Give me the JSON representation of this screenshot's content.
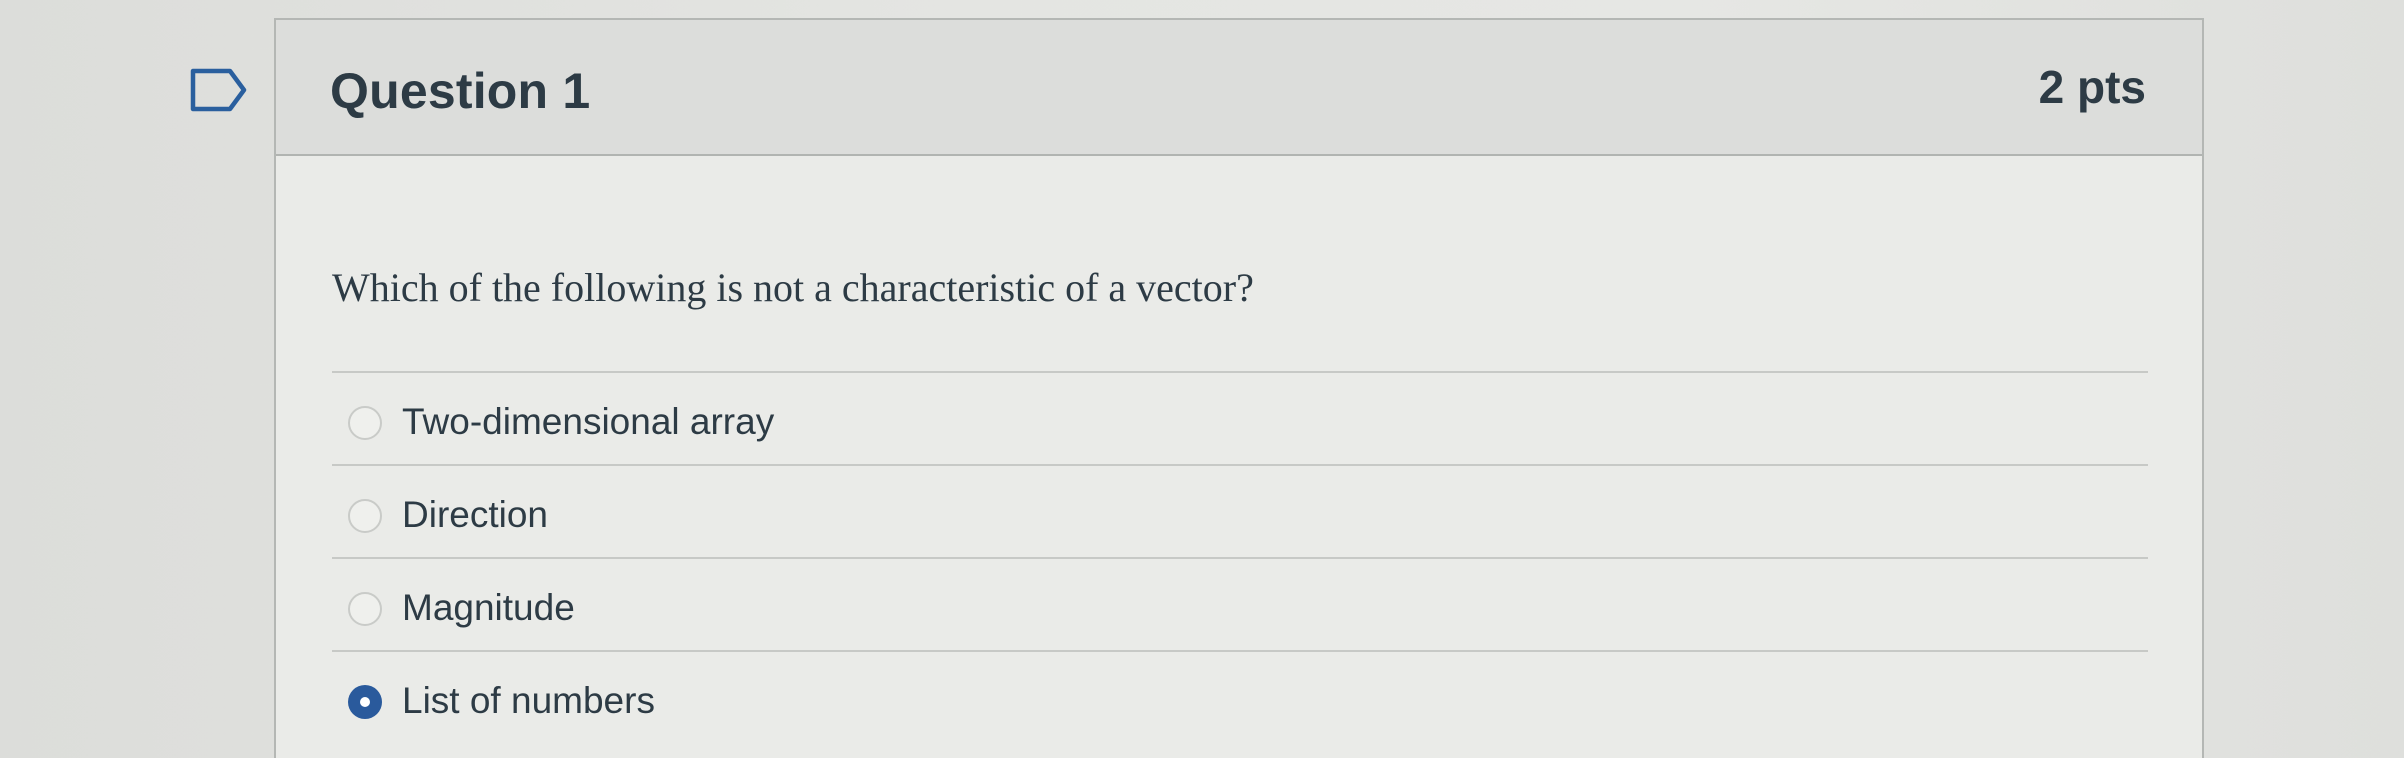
{
  "quiz": {
    "question": {
      "title": "Question 1",
      "points": "2 pts",
      "text": "Which of the following is not a characteristic of a vector?",
      "answers": [
        {
          "label": "Two-dimensional array",
          "selected": false
        },
        {
          "label": "Direction",
          "selected": false
        },
        {
          "label": "Magnitude",
          "selected": false
        },
        {
          "label": "List of numbers",
          "selected": true
        }
      ]
    },
    "icons": {
      "flag": "flag-question-icon"
    },
    "colors": {
      "selected_radio": "#2a5a9c",
      "text": "#2d3b45",
      "header_bg": "#dcdddb"
    }
  }
}
